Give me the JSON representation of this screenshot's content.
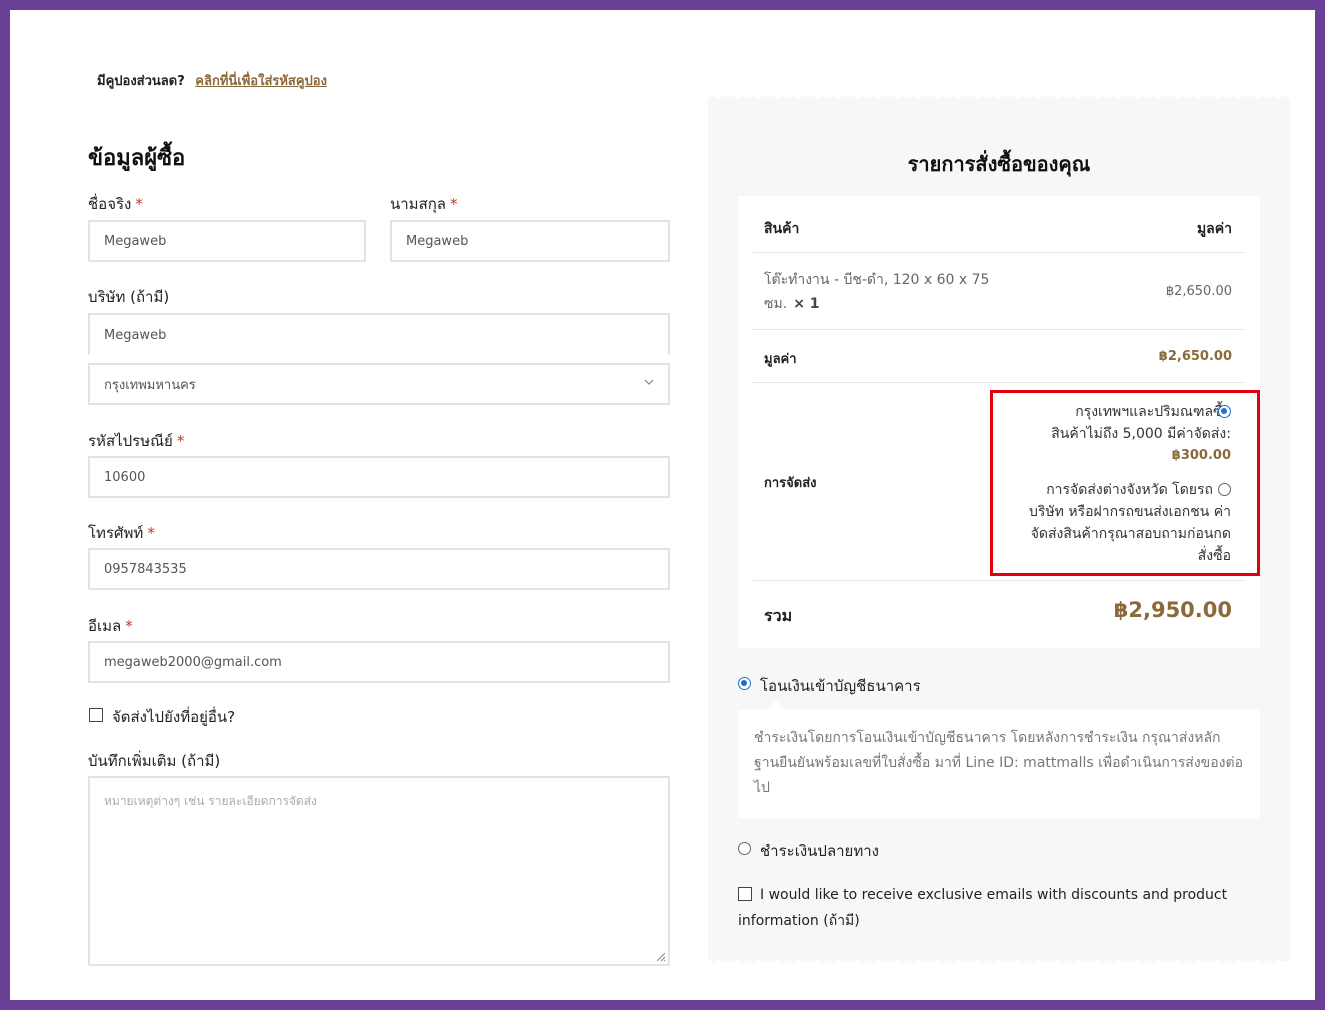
{
  "coupon": {
    "question": "มีคูปองส่วนลด?",
    "link": "คลิกที่นี่เพื่อใส่รหัสคูปอง"
  },
  "billing": {
    "title": "ข้อมูลผู้ซื้อ",
    "first_name": {
      "label": "ชื่อจริง",
      "value": "Megaweb"
    },
    "last_name": {
      "label": "นามสกุล",
      "value": "Megaweb"
    },
    "company": {
      "label": "บริษัท (ถ้ามี)",
      "value": "Megaweb"
    },
    "province": {
      "value": "กรุงเทพมหานคร"
    },
    "postcode": {
      "label": "รหัสไปรษณีย์",
      "value": "10600"
    },
    "phone": {
      "label": "โทรศัพท์",
      "value": "0957843535"
    },
    "email": {
      "label": "อีเมล",
      "value": "megaweb2000@gmail.com"
    },
    "ship_elsewhere": "จัดส่งไปยังที่อยู่อื่น?",
    "notes": {
      "label": "บันทึกเพิ่มเติม (ถ้ามี)",
      "placeholder": "หมายเหตุต่างๆ เช่น รายละเอียดการจัดส่ง"
    },
    "required_mark": "*"
  },
  "order": {
    "title": "รายการสั่งซื้อของคุณ",
    "col_product": "สินค้า",
    "col_value": "มูลค่า",
    "item_name": "โต๊ะทำงาน - บีช-ดำ, 120 x 60 x 75 ซม.",
    "item_qty": "× 1",
    "item_price": "฿2,650.00",
    "subtotal_label": "มูลค่า",
    "subtotal": "฿2,650.00",
    "shipping_label": "การจัดส่ง",
    "ship_option_1_line1": "กรุงเทพฯและปริมณฑลซื้อ",
    "ship_option_1_line2": "สินค้าไม่ถึง 5,000 มีค่าจัดส่ง:",
    "ship_option_1_price": "฿300.00",
    "ship_option_2_line1": "การจัดส่งต่างจังหวัด โดยรถ",
    "ship_option_2_line2": "บริษัท หรือฝากรถขนส่งเอกชน ค่า",
    "ship_option_2_line3": "จัดส่งสินค้ากรุณาสอบถามก่อนกด",
    "ship_option_2_line4": "สั่งซื้อ",
    "total_label": "รวม",
    "total": "฿2,950.00"
  },
  "payment": {
    "bank_label": "โอนเงินเข้าบัญชีธนาคาร",
    "bank_desc": "ชำระเงินโดยการโอนเงินเข้าบัญชีธนาคาร โดยหลังการชำระเงิน กรุณาส่งหลักฐานยืนยันพร้อมเลขที่ใบสั่งซื้อ มาที่ Line ID: mattmalls เพื่อดำเนินการส่งของต่อไป",
    "cod_label": "ชำระเงินปลายทาง",
    "newsletter": "I would like to receive exclusive emails with discounts and product information (ถ้ามี)"
  },
  "colors": {
    "frame": "#6a3f96",
    "accent": "#8a6a3a",
    "highlight": "#e0000b",
    "radio": "#1f6fd6"
  }
}
